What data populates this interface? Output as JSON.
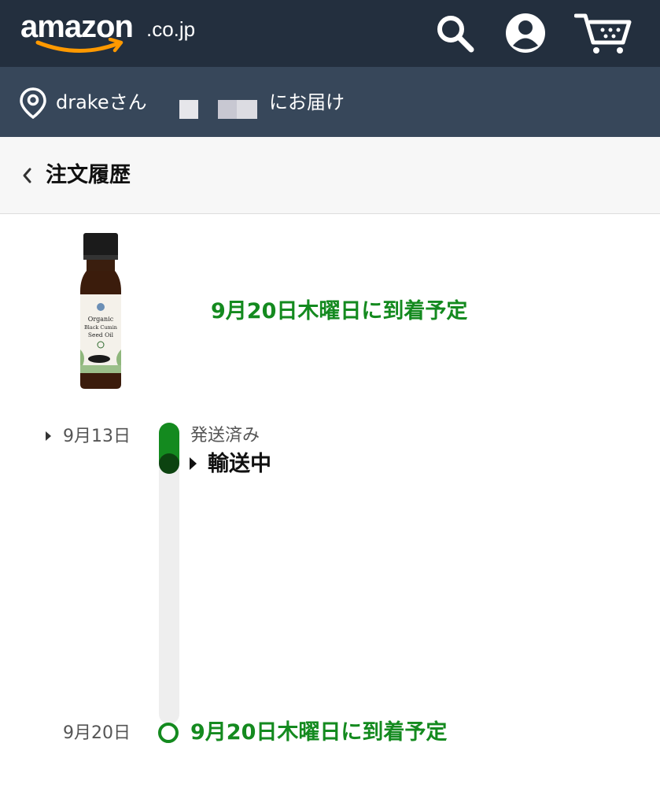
{
  "header": {
    "logo_word": "amazon",
    "logo_tld": ".co.jp",
    "icons": [
      "search-icon",
      "account-icon",
      "cart-icon"
    ],
    "background_color": "#232f3e"
  },
  "delivery": {
    "name": "drakeさん",
    "suffix": "にお届け",
    "background_color": "#37475a"
  },
  "page": {
    "title": "注文履歴"
  },
  "order": {
    "product_image_alt": "Organic Black Cumin Seed Oil",
    "arrival_text": "9月20日木曜日に到着予定"
  },
  "timeline": {
    "start_date": "9月13日",
    "shipped_label": "発送済み",
    "current_status": "輸送中",
    "end_date": "9月20日",
    "end_status": "9月20日木曜日に到着予定",
    "accent_color": "#148a1f"
  }
}
